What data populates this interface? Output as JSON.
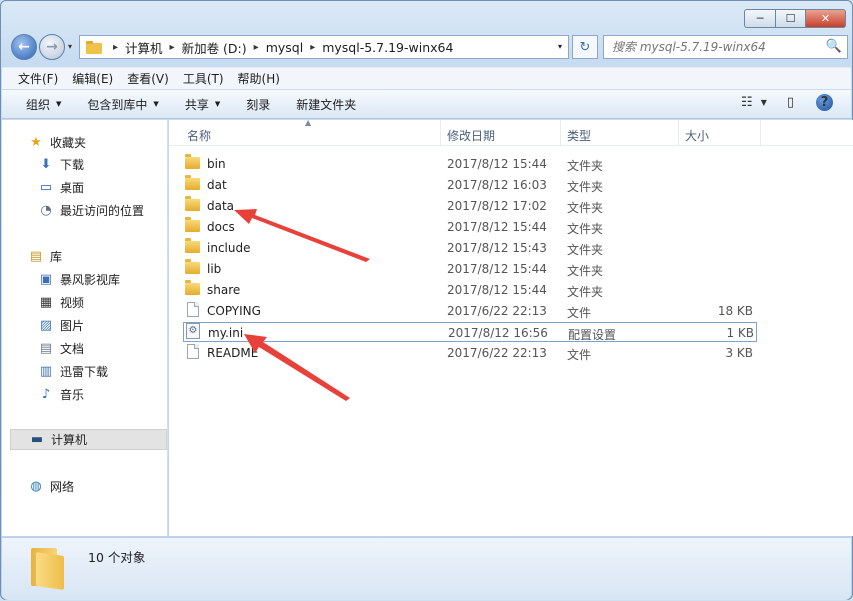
{
  "window": {
    "controls": {
      "min": "─",
      "max": "☐",
      "close": "✕"
    }
  },
  "address": {
    "crumbs": [
      "计算机",
      "新加卷 (D:)",
      "mysql",
      "mysql-5.7.19-winx64"
    ],
    "separator": "▸",
    "dropdown": "▾",
    "refresh": "↻"
  },
  "nav_buttons": {
    "back": "←",
    "forward": "→",
    "dropdown": "▾"
  },
  "search": {
    "placeholder": "搜索 mysql-5.7.19-winx64",
    "icon": "🔍"
  },
  "menubar": [
    "文件(F)",
    "编辑(E)",
    "查看(V)",
    "工具(T)",
    "帮助(H)"
  ],
  "toolbar": {
    "items": [
      "组织",
      "包含到库中",
      "共享",
      "刻录",
      "新建文件夹"
    ],
    "dropdown_arrow": "▼",
    "view_icon": "☷",
    "view_dropdown": "▼",
    "pane_icon": "▯",
    "help": "?"
  },
  "navpane": {
    "favorites": {
      "label": "收藏夹",
      "icon": "★",
      "items": [
        {
          "label": "下载",
          "icon": "⬇"
        },
        {
          "label": "桌面",
          "icon": "▭"
        },
        {
          "label": "最近访问的位置",
          "icon": "◔"
        }
      ]
    },
    "libraries": {
      "label": "库",
      "icon": "▤",
      "items": [
        {
          "label": "暴风影视库",
          "icon": "▣"
        },
        {
          "label": "视频",
          "icon": "▦"
        },
        {
          "label": "图片",
          "icon": "▨"
        },
        {
          "label": "文档",
          "icon": "▤"
        },
        {
          "label": "迅雷下载",
          "icon": "▥"
        },
        {
          "label": "音乐",
          "icon": "♪"
        }
      ]
    },
    "computer": {
      "label": "计算机",
      "icon": "▬"
    },
    "network": {
      "label": "网络",
      "icon": "◍"
    }
  },
  "columns": {
    "name": "名称",
    "date": "修改日期",
    "type": "类型",
    "size": "大小",
    "sort_arrow": "▲"
  },
  "files": [
    {
      "name": "bin",
      "date": "2017/8/12 15:44",
      "type": "文件夹",
      "size": "",
      "kind": "folder"
    },
    {
      "name": "dat",
      "date": "2017/8/12 16:03",
      "type": "文件夹",
      "size": "",
      "kind": "folder"
    },
    {
      "name": "data",
      "date": "2017/8/12 17:02",
      "type": "文件夹",
      "size": "",
      "kind": "folder"
    },
    {
      "name": "docs",
      "date": "2017/8/12 15:44",
      "type": "文件夹",
      "size": "",
      "kind": "folder"
    },
    {
      "name": "include",
      "date": "2017/8/12 15:43",
      "type": "文件夹",
      "size": "",
      "kind": "folder"
    },
    {
      "name": "lib",
      "date": "2017/8/12 15:44",
      "type": "文件夹",
      "size": "",
      "kind": "folder"
    },
    {
      "name": "share",
      "date": "2017/8/12 15:44",
      "type": "文件夹",
      "size": "",
      "kind": "folder"
    },
    {
      "name": "COPYING",
      "date": "2017/6/22 22:13",
      "type": "文件",
      "size": "18 KB",
      "kind": "file"
    },
    {
      "name": "my.ini",
      "date": "2017/8/12 16:56",
      "type": "配置设置",
      "size": "1 KB",
      "kind": "ini",
      "selected": true
    },
    {
      "name": "README",
      "date": "2017/6/22 22:13",
      "type": "文件",
      "size": "3 KB",
      "kind": "file"
    }
  ],
  "ini_glyph": "⚙",
  "status": {
    "text": "10 个对象"
  },
  "colors": {
    "arrow": "#e8413a",
    "selection_border": "#7da2ce"
  }
}
